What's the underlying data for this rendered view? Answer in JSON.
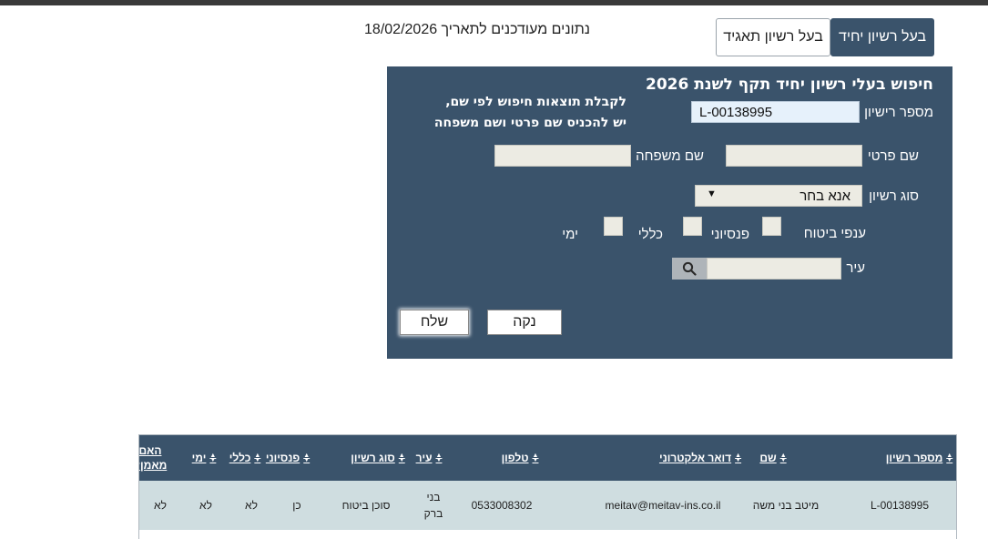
{
  "tabs": {
    "single": "בעל רשיון יחיד",
    "corporate": "בעל רשיון תאגיד"
  },
  "updated_text": "נתונים מעודכנים לתאריך 18/02/2026",
  "search": {
    "title": "חיפוש בעלי רשיון יחיד תקף לשנת 2026",
    "hint_line1": "לקבלת תוצאות חיפוש לפי שם,",
    "hint_line2": "יש להכניס שם פרטי ושם משפחה",
    "license_number_label": "מספר רישיון",
    "license_number_value": "L-00138995",
    "first_name_label": "שם פרטי",
    "first_name_value": "",
    "last_name_label": "שם משפחה",
    "last_name_value": "",
    "license_type_label": "סוג רשיון",
    "license_type_value": "אנא בחר",
    "branches_label": "ענפי ביטוח",
    "branch_pension": "פנסיוני",
    "branch_general": "כללי",
    "branch_marine": "ימי",
    "city_label": "עיר",
    "city_value": "",
    "clear_button": "נקה",
    "send_button": "שלח"
  },
  "table": {
    "headers": {
      "license_number": "מספר רשיון",
      "name": "שם",
      "email": "דואר אלקטרוני",
      "phone": "טלפון",
      "city": "עיר",
      "license_type": "סוג רשיון",
      "pension": "פנסיוני",
      "general": "כללי",
      "marine": "ימי",
      "trusted": "האם מאמן?"
    },
    "rows": [
      {
        "license_number": "L-00138995",
        "name": "מיטב בני משה",
        "email": "meitav@meitav-ins.co.il",
        "phone": "0533008302",
        "city": "בני ברק",
        "license_type": "סוכן ביטוח",
        "pension": "כן",
        "general": "לא",
        "marine": "לא",
        "trusted": "לא"
      }
    ]
  },
  "colors": {
    "panel": "#3a536b",
    "row_bg": "#cfdde0",
    "field_bg": "#ecebe3"
  }
}
